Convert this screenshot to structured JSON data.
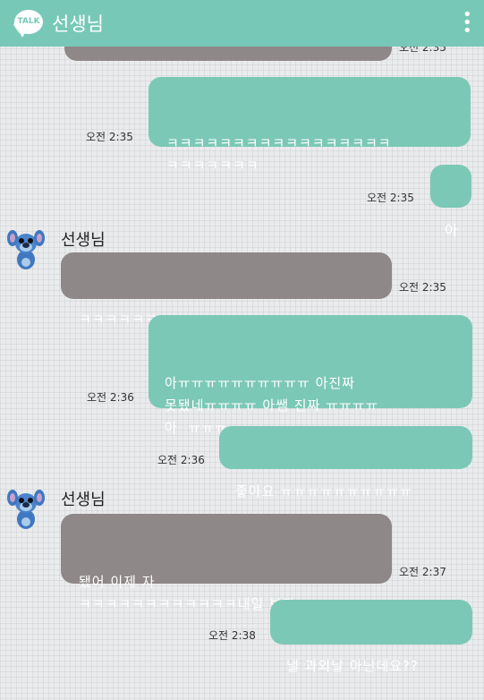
{
  "header": {
    "back_glyph": "〈",
    "logo_text": "TALK",
    "title": "선생님",
    "menu_glyph": "⋮"
  },
  "messages": [
    {
      "text": "",
      "time": "오전 2:35"
    },
    {
      "text": "ㅋㅋㅋㅋㅋㅋㅋㅋㅋㅋㅋㅋㅋㅋㅋㅋㅋ\nㅋㅋㅋㅋㅋㅋㅋ",
      "time": "오전 2:35"
    },
    {
      "text": "아",
      "time": "오전 2:35"
    },
    {
      "sender": "선생님",
      "text": "ㅋㅋㅋㅋㅋㅋㅋㅋㅋㅋㅋㅋㅋㅋㅋㅋㅋ",
      "time": "오전 2:35"
    },
    {
      "text": "아ㅠㅠㅠㅠㅠㅠㅠㅠㅠㅠ 아진짜\n못됐네ㅠㅠㅠㅠ 아쌤 진짜 ㅠㅠㅠㅠ\n아  ㅠㅠㅠ",
      "time": "오전 2:36"
    },
    {
      "text": "좋아요 ㅠㅠㅠㅠㅠㅠㅠㅠㅠㅠ",
      "time": "오전 2:36"
    },
    {
      "sender": "선생님",
      "text": "됐어 이제 자\nㅋㅋㅋㅋㅋㅋㅋㅋㅋㅋㅋㅋ내일 보자.",
      "time": "오전 2:37"
    },
    {
      "text": "낼 과외날 아닌데요??",
      "time": "오전 2:38"
    }
  ],
  "colors": {
    "header": "#78c8b8",
    "sent_bubble": "#7cc8b6",
    "received_bubble": "#8f8888",
    "background": "#e9ebec"
  },
  "icons": [
    "back-arrow-icon",
    "kakaotalk-logo-icon",
    "more-menu-icon",
    "stitch-avatar-icon"
  ]
}
